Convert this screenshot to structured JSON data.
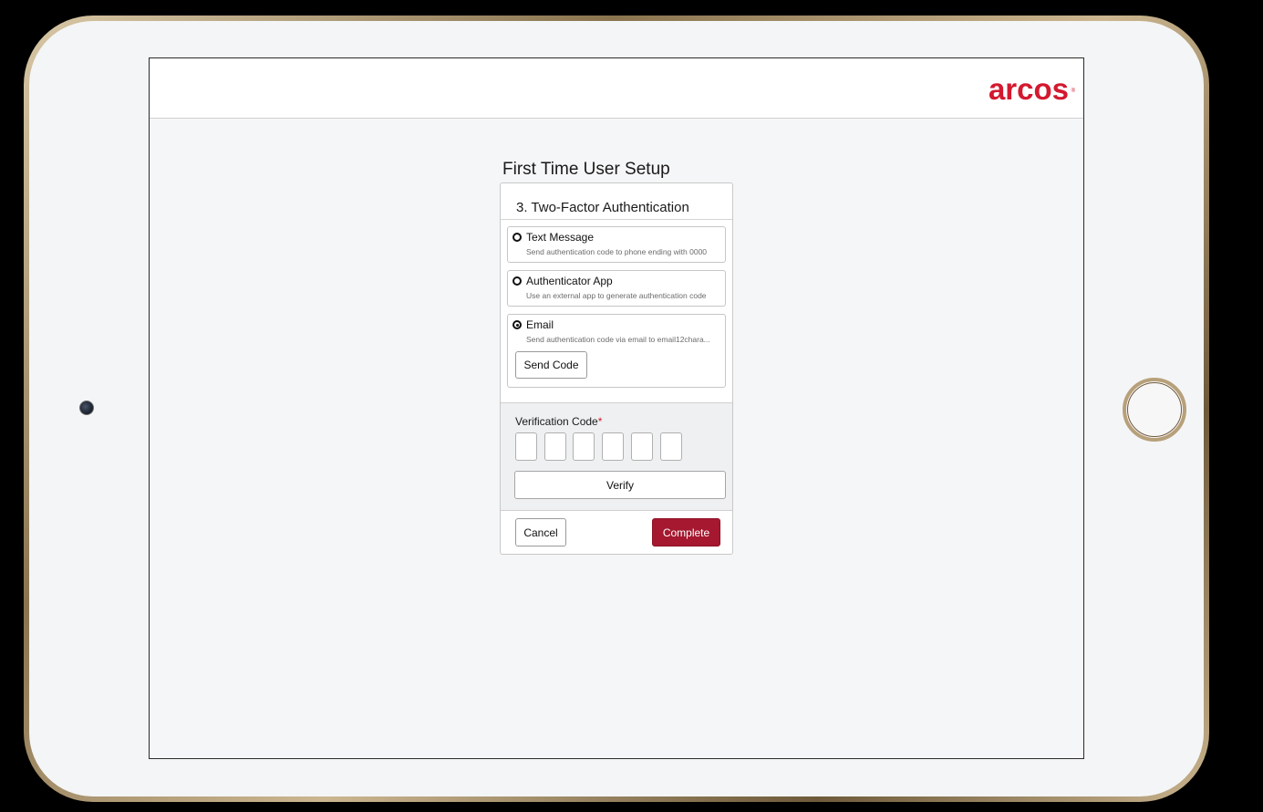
{
  "header": {
    "logo_text": "arcos",
    "logo_mark": "®"
  },
  "page": {
    "title": "First Time User Setup"
  },
  "card": {
    "step_title": "3. Two-Factor Authentication",
    "options": [
      {
        "label": "Text Message",
        "description": "Send authentication code to phone ending with 0000",
        "selected": false
      },
      {
        "label": "Authenticator App",
        "description": "Use an external app to generate authentication code",
        "selected": false
      },
      {
        "label": "Email",
        "description": "Send authentication code via email to email12chara...",
        "selected": true
      }
    ],
    "send_code_label": "Send Code",
    "verification": {
      "label": "Verification Code",
      "required_marker": "*",
      "code_digits": [
        "",
        "",
        "",
        "",
        "",
        ""
      ],
      "verify_label": "Verify"
    },
    "cancel_label": "Cancel",
    "complete_label": "Complete"
  },
  "colors": {
    "brand_red": "#d3192f",
    "complete_button": "#a5182f",
    "device_frame": "#b7a07a"
  },
  "icons": {
    "radio_unselected": "radio-unselected-icon",
    "radio_selected": "radio-selected-icon"
  }
}
